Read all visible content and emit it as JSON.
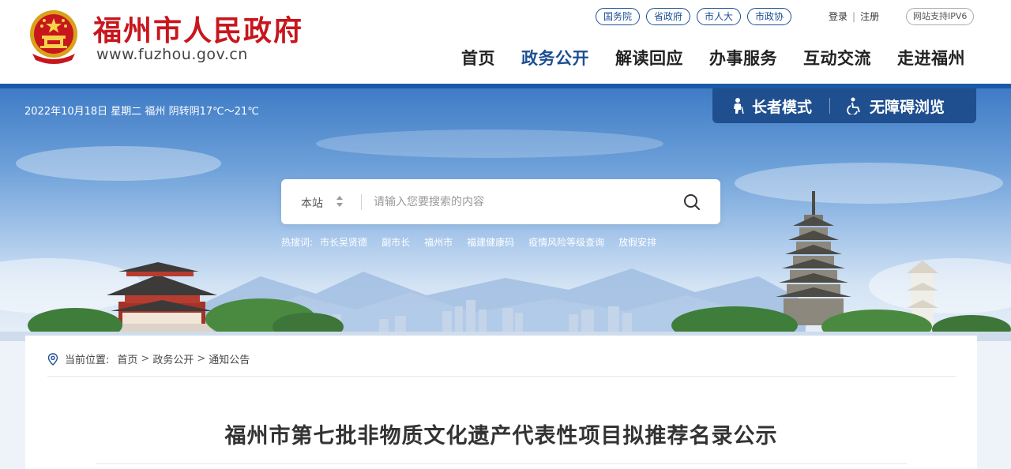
{
  "header": {
    "site_title": "福州市人民政府",
    "site_domain": "www.fuzhou.gov.cn",
    "quick_links": [
      "国务院",
      "省政府",
      "市人大",
      "市政协"
    ],
    "login": "登录",
    "auth_separator": "|",
    "register": "注册",
    "ipv6_badge": "网站支持IPV6",
    "nav": [
      "首页",
      "政务公开",
      "解读回应",
      "办事服务",
      "互动交流",
      "走进福州"
    ],
    "active_nav": "政务公开"
  },
  "banner": {
    "date_weather": "2022年10月18日 星期二 福州 阴转阴17℃～21℃",
    "elder_mode": "长者模式",
    "accessible_browse": "无障碍浏览",
    "search": {
      "scope": "本站",
      "placeholder": "请输入您要搜索的内容"
    },
    "hot_label": "热搜词:",
    "hot_words": [
      "市长吴贤德",
      "副市长",
      "福州市",
      "福建健康码",
      "疫情风险等级查询",
      "放假安排"
    ]
  },
  "content": {
    "breadcrumb_label": "当前位置:",
    "breadcrumb": [
      "首页",
      "政务公开",
      "通知公告"
    ],
    "breadcrumb_separator": ">",
    "title": "福州市第七批非物质文化遗产代表性项目拟推荐名录公示"
  },
  "colors": {
    "brand_red": "#c8161d",
    "brand_blue": "#1c4f93",
    "header_bar": "#1a5aa8",
    "access_bar": "#1f4f8f"
  },
  "icons": [
    "national-emblem-icon",
    "elder-icon",
    "wheelchair-icon",
    "updown-arrows-icon",
    "search-icon",
    "location-pin-icon"
  ]
}
